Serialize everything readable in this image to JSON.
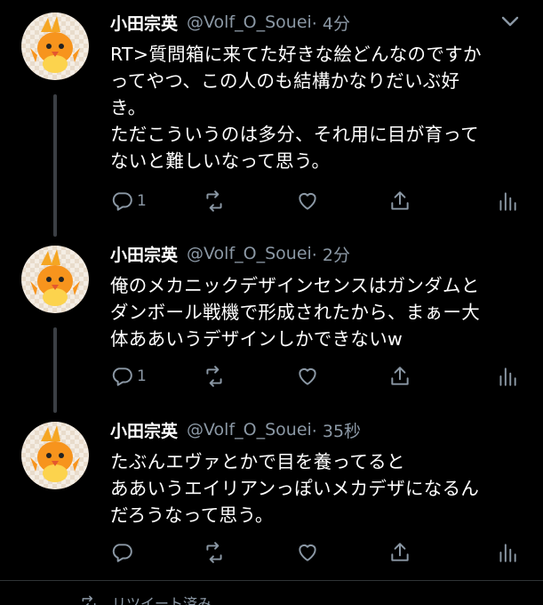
{
  "tweets": [
    {
      "name": "小田宗英",
      "handle": "@Volf_O_Souei",
      "time": "· 4分",
      "text": "RT>質問箱に来てた好きな絵どんなのですか\nってやつ、この人のも結構かなりだいぶ好\nき。\nただこういうのは多分、それ用に目が育って\nないと難しいなって思う。",
      "reply_count": "1",
      "icons": [
        "reply-icon",
        "retweet-icon",
        "like-icon",
        "share-icon",
        "analytics-icon"
      ]
    },
    {
      "name": "小田宗英",
      "handle": "@Volf_O_Souei",
      "time": "· 2分",
      "text": "俺のメカニックデザインセンスはガンダムと\nダンボール戦機で形成されたから、まぁー大\n体ああいうデザインしかできないw",
      "reply_count": "1",
      "icons": [
        "reply-icon",
        "retweet-icon",
        "like-icon",
        "share-icon",
        "analytics-icon"
      ]
    },
    {
      "name": "小田宗英",
      "handle": "@Volf_O_Souei",
      "time": "· 35秒",
      "text": "たぶんエヴァとかで目を養ってると\nああいうエイリアンっぽいメカデザになるん\nだろうなって思う。",
      "reply_count": "",
      "icons": [
        "reply-icon",
        "retweet-icon",
        "like-icon",
        "share-icon",
        "analytics-icon"
      ]
    }
  ],
  "footer": {
    "retweeted_label": "リツイート済み"
  },
  "colors": {
    "background": "#000000",
    "text": "#ffffff",
    "secondary": "#8b98a5",
    "thread_line": "#3b3f44"
  }
}
